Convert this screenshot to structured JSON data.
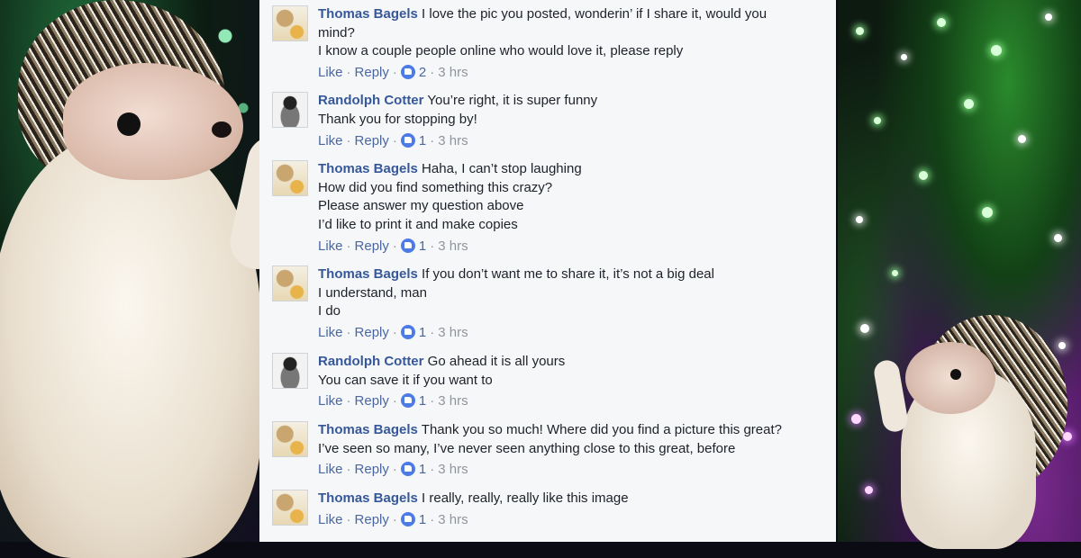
{
  "icons": {
    "like_reaction": "thumbs-up-icon",
    "avatar_thomas": "avatar-thomas-bagels",
    "avatar_randolph": "avatar-randolph-cotter"
  },
  "colors": {
    "author": "#365899",
    "link": "#4b67a1",
    "text": "#1d2129",
    "like_badge": "#4c7be6",
    "panel_bg": "#f6f7f9"
  },
  "comments": [
    {
      "author": "Thomas Bagels",
      "lines": [
        "I love the pic you posted, wonderin’ if I share it, would you",
        "mind?",
        "I know a couple people online who would love it, please reply"
      ],
      "actions": {
        "like": "Like",
        "reply": "Reply",
        "sep": "·",
        "count": "2",
        "time": "3 hrs"
      }
    },
    {
      "author": "Randolph Cotter",
      "lines": [
        "You’re right, it is super funny",
        "Thank you for stopping by!"
      ],
      "actions": {
        "like": "Like",
        "reply": "Reply",
        "sep": "·",
        "count": "1",
        "time": "3 hrs"
      }
    },
    {
      "author": "Thomas Bagels",
      "lines": [
        "Haha, I can’t stop laughing",
        "How did you find something this crazy?",
        "Please answer my question above",
        "I’d like to print it and make copies"
      ],
      "actions": {
        "like": "Like",
        "reply": "Reply",
        "sep": "·",
        "count": "1",
        "time": "3 hrs"
      }
    },
    {
      "author": "Thomas Bagels",
      "lines": [
        "If you don’t want me to share it, it’s not a big deal",
        "I understand, man",
        "I do"
      ],
      "actions": {
        "like": "Like",
        "reply": "Reply",
        "sep": "·",
        "count": "1",
        "time": "3 hrs"
      }
    },
    {
      "author": "Randolph Cotter",
      "lines": [
        "Go ahead it is all yours",
        "You can save it if you want to"
      ],
      "actions": {
        "like": "Like",
        "reply": "Reply",
        "sep": "·",
        "count": "1",
        "time": "3 hrs"
      }
    },
    {
      "author": "Thomas Bagels",
      "lines": [
        "Thank you so much! Where did you find a picture this great?",
        "I’ve seen so many, I’ve never seen anything close to this great, before"
      ],
      "actions": {
        "like": "Like",
        "reply": "Reply",
        "sep": "·",
        "count": "1",
        "time": "3 hrs"
      }
    },
    {
      "author": "Thomas Bagels",
      "lines": [
        "I really, really, really like this image"
      ],
      "actions": {
        "like": "Like",
        "reply": "Reply",
        "sep": "·",
        "count": "1",
        "time": "3 hrs"
      }
    }
  ]
}
